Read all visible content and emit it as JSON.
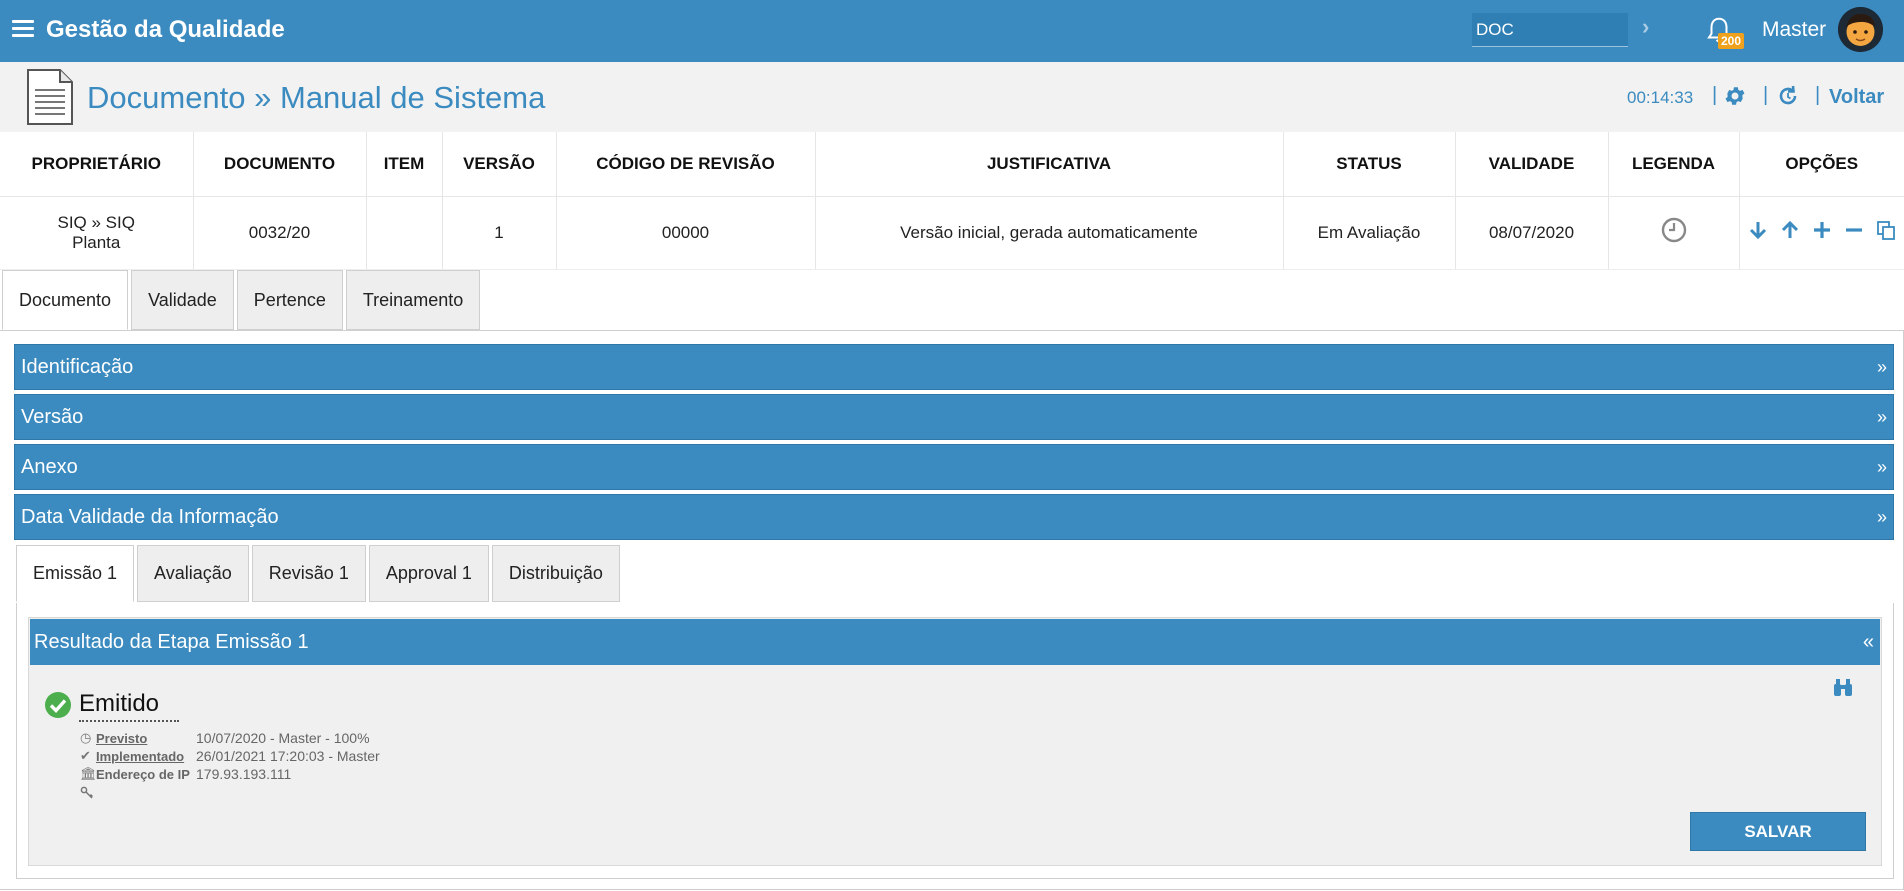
{
  "topbar": {
    "app_title": "Gestão da Qualidade",
    "search_value": "DOC",
    "go_arrow": "›",
    "notification_count": "200",
    "user_name": "Master"
  },
  "header": {
    "page_title": "Documento » Manual de Sistema",
    "timer": "00:14:33",
    "separator": "|",
    "back_label": "Voltar"
  },
  "table": {
    "columns": [
      "PROPRIETÁRIO",
      "DOCUMENTO",
      "ITEM",
      "VERSÃO",
      "CÓDIGO DE REVISÃO",
      "JUSTIFICATIVA",
      "STATUS",
      "VALIDADE",
      "LEGENDA",
      "OPÇÕES"
    ],
    "row": {
      "owner_line1": "SIQ » SIQ",
      "owner_line2": "Planta",
      "document": "0032/20",
      "item": "",
      "version": "1",
      "revision_code": "00000",
      "justification": "Versão inicial, gerada automaticamente",
      "status": "Em Avaliação",
      "validity": "08/07/2020"
    }
  },
  "main_tabs": [
    "Documento",
    "Validade",
    "Pertence",
    "Treinamento"
  ],
  "accordions": [
    "Identificação",
    "Versão",
    "Anexo",
    "Data Validade da Informação"
  ],
  "accordion_chevron": "»",
  "sub_tabs": [
    "Emissão 1",
    "Avaliação",
    "Revisão 1",
    "Approval 1",
    "Distribuição"
  ],
  "result": {
    "title": "Resultado da Etapa Emissão 1",
    "collapse_chevron": "«",
    "status": "Emitido",
    "planned_label": "Previsto",
    "planned_value": "10/07/2020 - Master - 100%",
    "implemented_label": "Implementado",
    "implemented_value": "26/01/2021 17:20:03 - Master",
    "ip_label": "Endereço de IP",
    "ip_value": "179.93.193.111",
    "save_label": "SALVAR"
  },
  "colors": {
    "primary": "#3b8bc0",
    "badge": "#f0a11c",
    "success": "#4cae4c"
  },
  "icons": [
    "menu-icon",
    "bell-icon",
    "avatar",
    "document-icon",
    "gear-icon",
    "refresh-icon",
    "clock-icon",
    "arrow-down-icon",
    "arrow-up-icon",
    "plus-icon",
    "minus-icon",
    "copy-icon",
    "check-circle-icon",
    "binoculars-icon",
    "check-icon",
    "bank-icon",
    "key-icon"
  ]
}
